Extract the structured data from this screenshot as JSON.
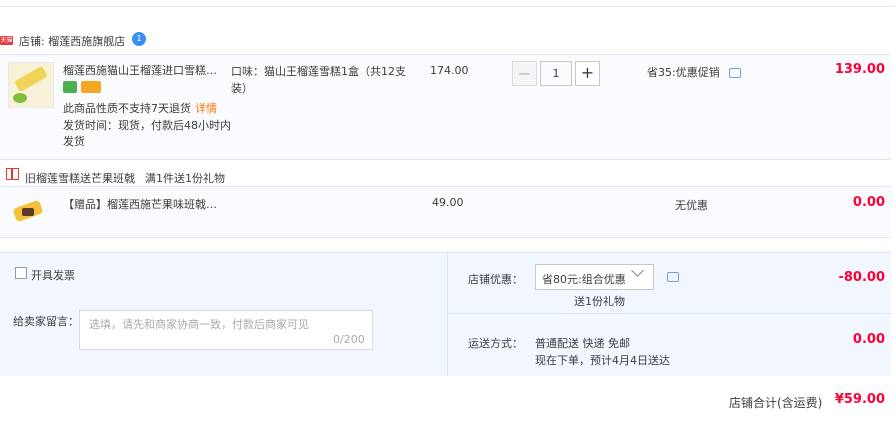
{
  "shop": {
    "badge": "天猫",
    "name_label": "店铺: 榴莲西施旗舰店",
    "ww_badge": "1"
  },
  "item1": {
    "title": "榴莲西施猫山王榴莲进口雪糕条...",
    "policy": "此商品性质不支持7天退货",
    "policy_link": "详情",
    "ship_time": "发货时间：现货，付款后48小时内发货",
    "sku": "口味：猫山王榴莲雪糕1盒（共12支装）",
    "unit_price": "174.00",
    "quantity": "1",
    "qty_minus": "−",
    "qty_plus": "+",
    "promo": "省35:优惠促销",
    "subtotal": "139.00"
  },
  "gift_rule": {
    "name": "旧榴莲雪糕送芒果班戟",
    "rule": "满1件送1份礼物"
  },
  "item2": {
    "title": "【赠品】榴莲西施芒果味班戟1...",
    "unit_price": "49.00",
    "promo": "无优惠",
    "subtotal": "0.00"
  },
  "order": {
    "invoice_label": "开具发票",
    "memo_label": "给卖家留言：",
    "memo_placeholder": "选填，请先和商家协商一致，付款后商家可见",
    "memo_count": "0/200",
    "discount_label": "店铺优惠：",
    "discount_value": "省80元:组合优惠",
    "discount_gift": "送1份礼物",
    "discount_amount": "-80.00",
    "shipping_label": "运送方式：",
    "shipping_method": "普通配送 快递 免邮",
    "shipping_eta": "现在下单，预计4月4日送达",
    "shipping_amount": "0.00",
    "total_label": "店铺合计(含运费)",
    "total_amount": "¥59.00"
  },
  "colors": {
    "price_red": "#ff0036",
    "link_orange": "#ff7300",
    "panel_bg": "#f2f7ff",
    "row_bg": "#fafbff"
  }
}
